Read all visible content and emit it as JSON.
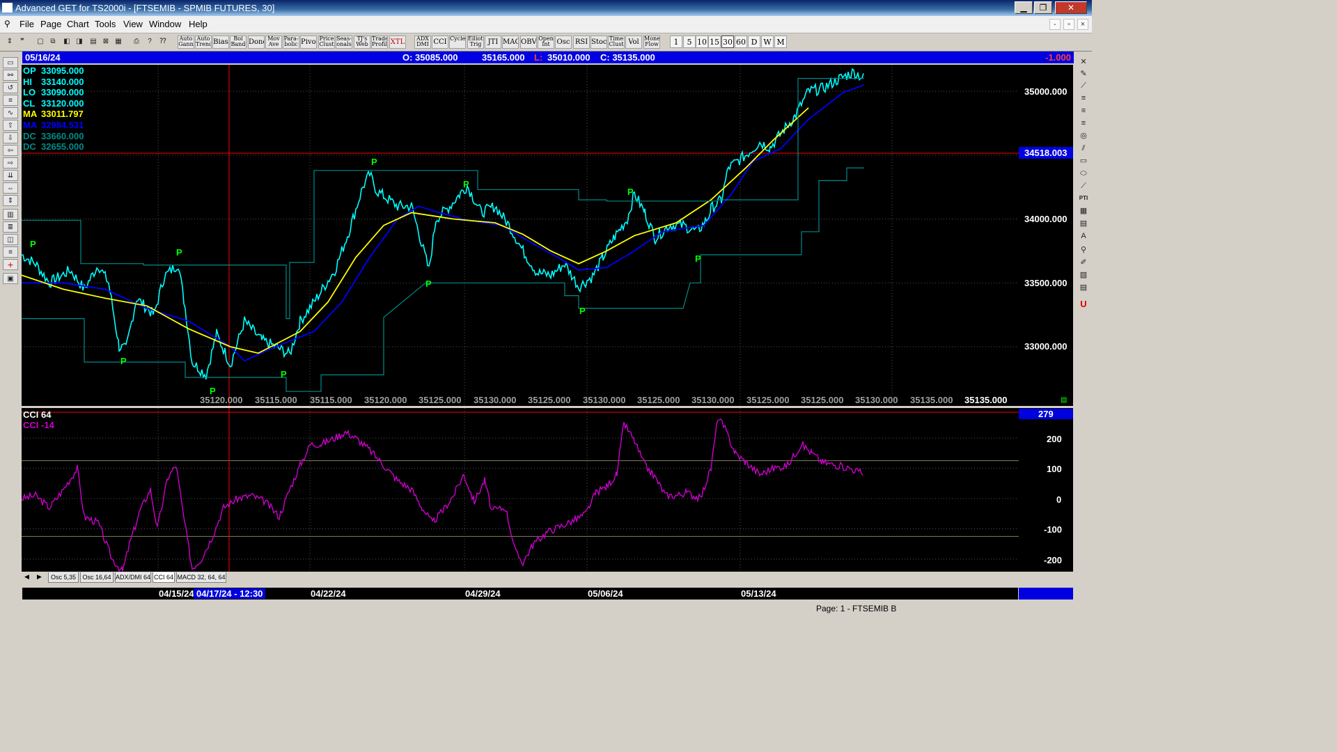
{
  "window": {
    "title": "Advanced GET for TS2000i - [FTSEMIB - SPMIB FUTURES, 30]",
    "controls": [
      "minimize-icon",
      "maximize-icon",
      "close-icon"
    ]
  },
  "menu": {
    "items": [
      "File",
      "Page",
      "Chart",
      "Tools",
      "View",
      "Window",
      "Help"
    ],
    "mdi_controls": [
      "-",
      "▫",
      "×"
    ]
  },
  "toolbar": {
    "studies": [
      "Auto Gann",
      "Auto Trend",
      "Bias",
      "Bol Band",
      "Donch",
      "Mov Ave",
      "Para-bolic",
      "Pivot",
      "Price Clust",
      "Seas-onals",
      "TJ's Web",
      "Trade Profile",
      "XTL",
      "ADX DMI",
      "CCI",
      "Cycles",
      "Elliott Trig",
      "JTI",
      "MACD",
      "OBV",
      "Open Int",
      "Osc",
      "RSI",
      "Stoch",
      "Time Clust",
      "Vol",
      "Money Flow"
    ],
    "timeframes": [
      "1",
      "5",
      "10",
      "15",
      "30",
      "60",
      "D",
      "W",
      "M"
    ],
    "active_timeframe": "30"
  },
  "info_bar": {
    "date": "05/16/24",
    "open": "O: 35085.000",
    "high": "35165.000",
    "low_prefix": "L:",
    "low": "35010.000",
    "close": "C: 35135.000",
    "change": "-1.000"
  },
  "price_panel": {
    "readouts": [
      {
        "label": "OP",
        "value": "33095.000",
        "color": "#00ffff"
      },
      {
        "label": "HI",
        "value": "33140.000",
        "color": "#00ffff"
      },
      {
        "label": "LO",
        "value": "33090.000",
        "color": "#00ffff"
      },
      {
        "label": "CL",
        "value": "33120.000",
        "color": "#00ffff"
      },
      {
        "label": "MA",
        "value": "33011.797",
        "color": "#ffff00"
      },
      {
        "label": "MA",
        "value": "32984.531",
        "color": "#0000ff"
      },
      {
        "label": "DC",
        "value": "33660.000",
        "color": "#008b8b"
      },
      {
        "label": "DC",
        "value": "32655.000",
        "color": "#008b8b"
      }
    ],
    "axis_ticks": [
      "35000.000",
      "34000.000",
      "33500.000",
      "33000.000"
    ],
    "current_price_marker": "34518.003",
    "bottom_labels": [
      "35120.000",
      "35115.000",
      "35115.000",
      "35120.000",
      "35125.000",
      "35130.000",
      "35125.000",
      "35130.000",
      "35125.000",
      "35130.000",
      "35125.000",
      "35125.000",
      "35130.000",
      "35135.000"
    ],
    "bottom_last_label": "35135.000",
    "pivot_label": "P",
    "colors": {
      "price": "#00ffff",
      "ma_fast": "#ffff00",
      "ma_slow": "#0000ff",
      "donchian": "#008b8b",
      "pivot": "#00ff00",
      "marker": "#ff0000"
    }
  },
  "cci_panel": {
    "title": "CCI 64",
    "value_label": "CCI  -14",
    "axis_ticks": [
      "200",
      "100",
      "0",
      "-100",
      "-200"
    ],
    "current_marker": "279",
    "color": "#cc00cc"
  },
  "tabs": [
    "Osc 5,35",
    "Osc 16,64",
    "ADX/DMI 64",
    "CCI 64",
    "MACD 32, 64, 64"
  ],
  "active_tab": "CCI 64",
  "date_axis": {
    "labels": [
      "04/15/24",
      "04/22/24",
      "04/29/24",
      "05/06/24",
      "05/13/24"
    ],
    "cursor_label": "04/17/24 - 12:30"
  },
  "status": {
    "page": "Page: 1 - FTSEMIB B"
  }
}
